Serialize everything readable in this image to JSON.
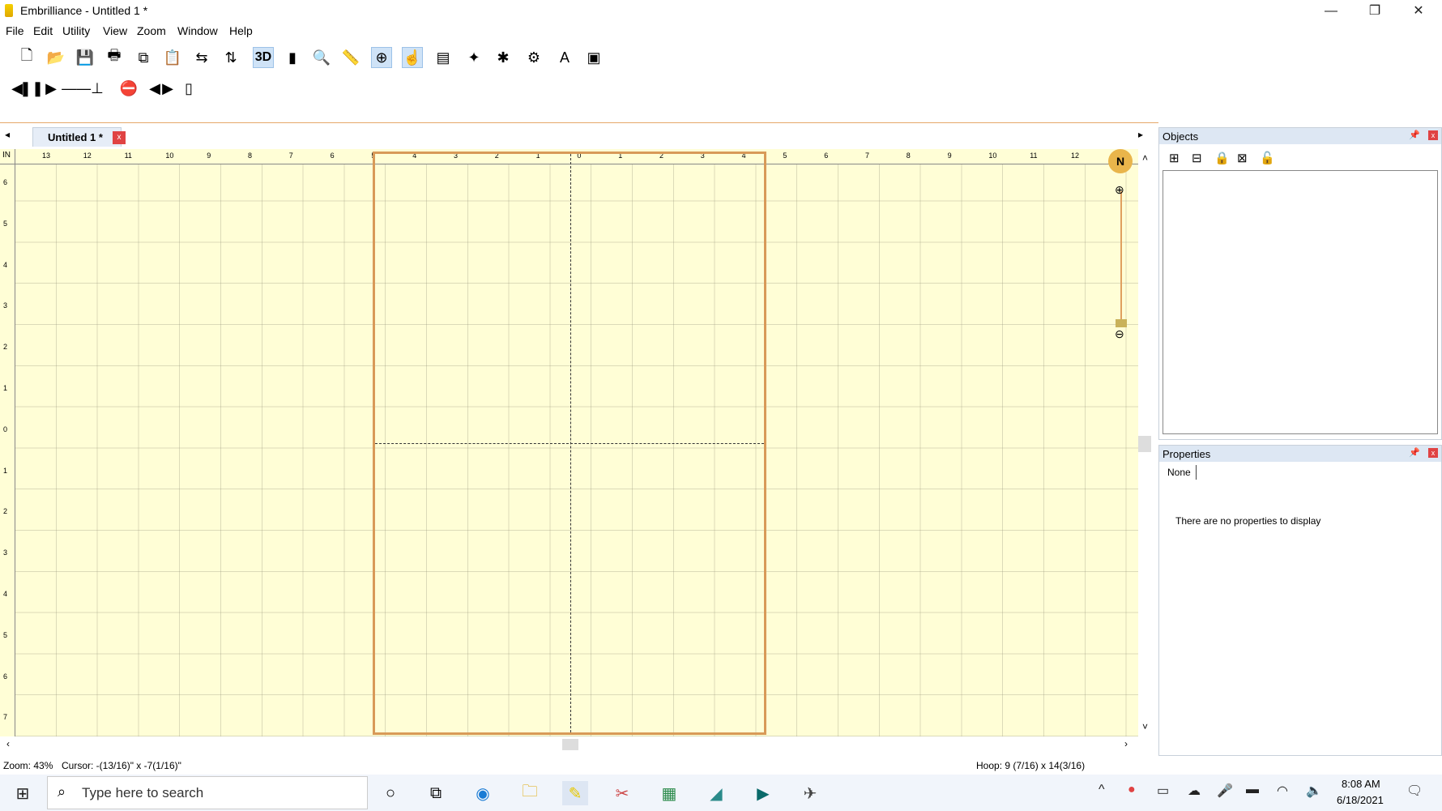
{
  "window": {
    "app_name": "Embrilliance - ",
    "doc_title": "Untitled 1 *",
    "minimize": "—",
    "restore": "❐",
    "close": "✕"
  },
  "menu": [
    "File",
    "Edit",
    "Utility",
    "View",
    "Zoom",
    "Window",
    "Help"
  ],
  "toolbar1": [
    {
      "name": "new-icon",
      "glyph": "🗋"
    },
    {
      "name": "open-icon",
      "glyph": "📂"
    },
    {
      "name": "save-icon",
      "glyph": "💾"
    },
    {
      "name": "print-icon",
      "glyph": "🖶"
    },
    {
      "name": "copy-icon",
      "glyph": "⧉"
    },
    {
      "name": "paste-icon",
      "glyph": "📋"
    },
    {
      "name": "mirror-h-icon",
      "glyph": "⇆"
    },
    {
      "name": "mirror-v-icon",
      "glyph": "⇅"
    },
    {
      "name": "3d-toggle",
      "glyph": "3D"
    },
    {
      "name": "color-chart-icon",
      "glyph": "▮"
    },
    {
      "name": "zoom-tool-icon",
      "glyph": "🔍"
    },
    {
      "name": "measure-icon",
      "glyph": "📏"
    },
    {
      "name": "hoop-center-icon",
      "glyph": "⊕"
    },
    {
      "name": "select-tool-icon",
      "glyph": "☝"
    },
    {
      "name": "properties-icon",
      "glyph": "▤"
    },
    {
      "name": "applique-icon",
      "glyph": "✦"
    },
    {
      "name": "stitch-icon",
      "glyph": "✱"
    },
    {
      "name": "settings-icon",
      "glyph": "⚙"
    },
    {
      "name": "text-tool-icon",
      "glyph": "A"
    },
    {
      "name": "export-icon",
      "glyph": "▣"
    }
  ],
  "toolbar2": [
    {
      "name": "prev-stitch-icon",
      "glyph": "◀"
    },
    {
      "name": "pause-icon",
      "glyph": "❚❚"
    },
    {
      "name": "play-icon",
      "glyph": "▶"
    },
    {
      "name": "stitch-slider",
      "glyph": "——⊥"
    },
    {
      "name": "stop-icon",
      "glyph": "⛔"
    },
    {
      "name": "step-back-icon",
      "glyph": "◀"
    },
    {
      "name": "step-forward-icon",
      "glyph": "▶"
    },
    {
      "name": "color-swatch",
      "glyph": "▯"
    }
  ],
  "tab": {
    "label": "Untitled 1 *",
    "close": "x"
  },
  "ruler": {
    "unit": "IN",
    "top_ticks": [
      "13",
      "12",
      "11",
      "10",
      "9",
      "8",
      "7",
      "6",
      "5",
      "4",
      "3",
      "2",
      "1",
      "0",
      "1",
      "2",
      "3",
      "4",
      "5",
      "6",
      "7",
      "8",
      "9",
      "10",
      "11",
      "12"
    ],
    "left_ticks": [
      "6",
      "5",
      "4",
      "3",
      "2",
      "1",
      "0",
      "1",
      "2",
      "3",
      "4",
      "5",
      "6",
      "7"
    ]
  },
  "compass": "N",
  "zoom_slider": {
    "plus": "⊕",
    "minus": "⊖"
  },
  "objects_panel": {
    "title": "Objects",
    "pin": "📌",
    "close": "x"
  },
  "object_tools": [
    {
      "name": "group-icon",
      "glyph": "⊞"
    },
    {
      "name": "ungroup-icon",
      "glyph": "⊟"
    },
    {
      "name": "lock-icon",
      "glyph": "🔒"
    },
    {
      "name": "delete-icon",
      "glyph": "⊠"
    },
    {
      "name": "unlock-icon",
      "glyph": "🔓"
    }
  ],
  "properties_panel": {
    "title": "Properties",
    "pin": "📌",
    "close": "x",
    "tab": "None",
    "empty_message": "There are no properties to display"
  },
  "status": {
    "zoom": "Zoom: 43%",
    "cursor": "Cursor: -(13/16)\" x -7(1/16)\"",
    "hoop": "Hoop: 9 (7/16) x 14(3/16)"
  },
  "taskbar": {
    "search_placeholder": "Type here to search",
    "time": "8:08 AM",
    "date": "6/18/2021"
  },
  "colors": {
    "canvas": "#fffed6",
    "hoop_border": "#d89a58",
    "accent": "#e04343"
  }
}
